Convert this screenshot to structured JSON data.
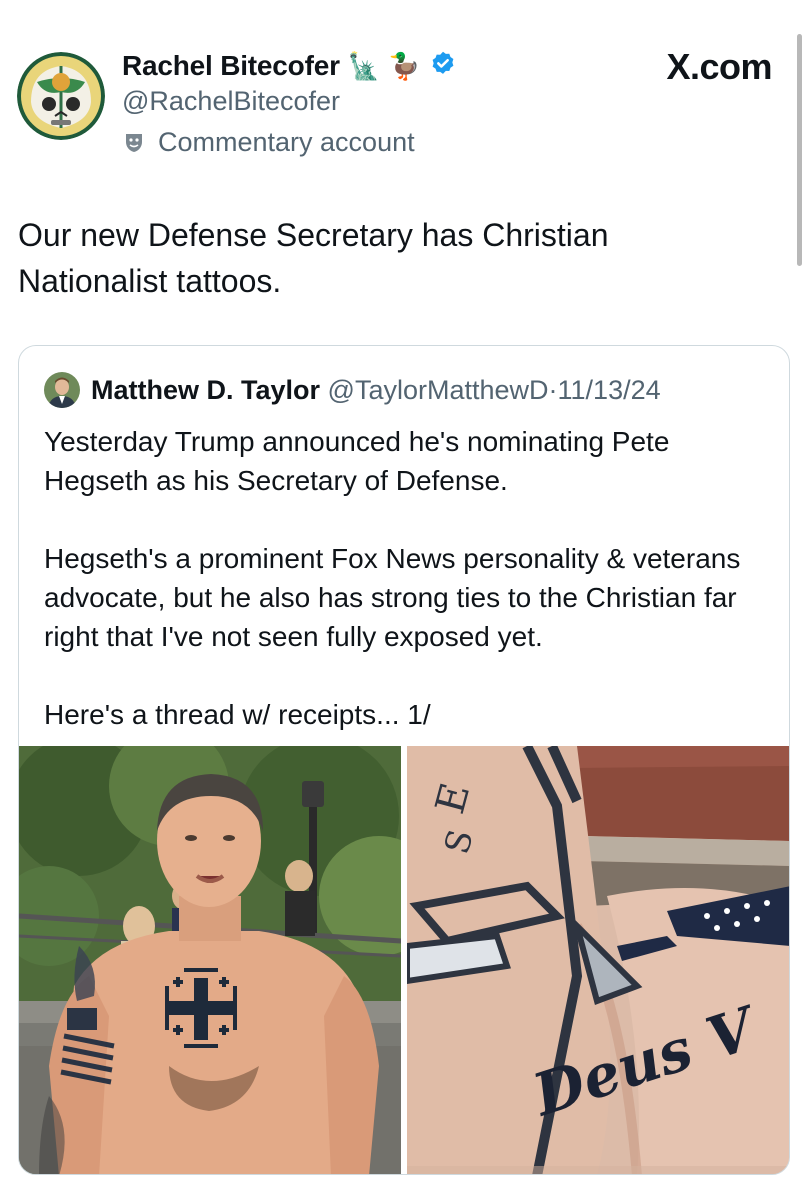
{
  "header": {
    "display_name": "Rachel Bitecofer",
    "emoji_1": "🗽",
    "emoji_2": "🦆",
    "handle": "@RachelBitecofer",
    "account_label": "Commentary account",
    "brand": "X.com"
  },
  "tweet": {
    "text": "Our new Defense Secretary has Christian Nationalist tattoos."
  },
  "quote": {
    "name": "Matthew D. Taylor",
    "handle": "@TaylorMatthewD",
    "separator": "·",
    "date": "11/13/24",
    "paragraphs": [
      "Yesterday Trump announced he's nominating Pete Hegseth as his Secretary of Defense.",
      "Hegseth's a prominent Fox News personality & veterans advocate, but he also has strong ties to the Christian far right that I've not seen fully exposed yet.",
      "Here's a thread w/ receipts... 1/"
    ],
    "tattoo_text": "Deus V"
  },
  "colors": {
    "text": "#0f1419",
    "secondary": "#536471",
    "verified": "#1d9bf0",
    "border": "#cfd9de"
  },
  "icons": [
    "verified-badge-icon",
    "commentary-mask-icon"
  ]
}
